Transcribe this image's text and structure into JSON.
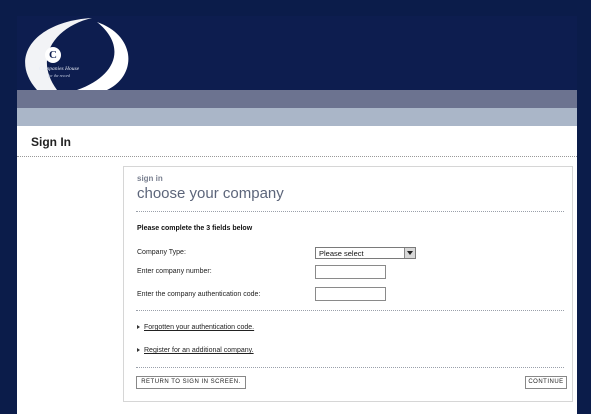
{
  "header": {
    "logo": {
      "icon": "companies-house-crest-icon",
      "letter": "C",
      "name": "Companies House",
      "tagline": "for the record"
    }
  },
  "page": {
    "title": "Sign In"
  },
  "panel": {
    "small_title": "sign in",
    "heading": "choose your company",
    "instructions": "Please complete the 3 fields below",
    "fields": {
      "company_type_label": "Company Type:",
      "company_type_value": "Please select",
      "company_number_label": "Enter company number:",
      "auth_code_label": "Enter the company authentication code:"
    },
    "links": {
      "forgotten_auth": "Forgotten your authentication code.",
      "register_additional": "Register for an additional company."
    },
    "buttons": {
      "return": "RETURN TO SIGN IN SCREEN.",
      "continue": "CONTINUE"
    }
  },
  "colors": {
    "header_navy": "#0d1d4f",
    "band_dark": "#6c7390",
    "band_light": "#aab6c8",
    "heading_gray": "#5c657a"
  }
}
